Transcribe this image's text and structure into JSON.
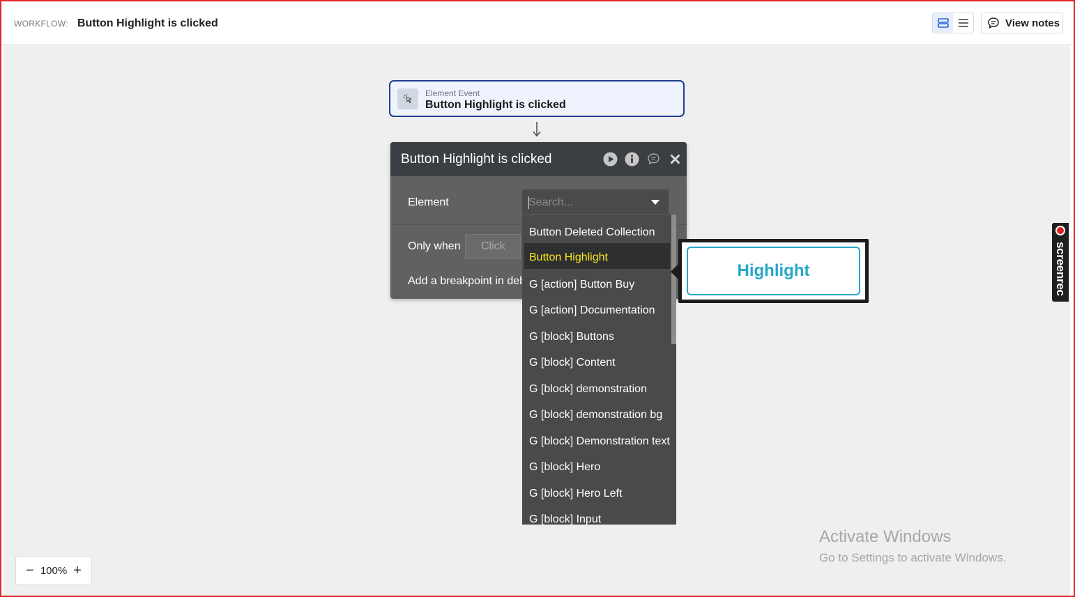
{
  "header": {
    "workflow_label": "WORKFLOW:",
    "workflow_title": "Button Highlight is clicked",
    "view_notes_label": "View notes"
  },
  "event_card": {
    "type": "Element Event",
    "name": "Button Highlight is clicked"
  },
  "panel": {
    "title": "Button Highlight is clicked",
    "element_label": "Element",
    "search_placeholder": "Search...",
    "only_when_label": "Only when",
    "only_when_value": "Click",
    "breakpoint_label": "Add a breakpoint in deb"
  },
  "dropdown": {
    "items": [
      {
        "label": "Button Deleted Collection",
        "selected": false
      },
      {
        "label": "Button Highlight",
        "selected": true
      },
      {
        "label": "G [action] Button Buy",
        "selected": false
      },
      {
        "label": "G [action] Documentation",
        "selected": false
      },
      {
        "label": "G [block] Buttons",
        "selected": false
      },
      {
        "label": "G [block] Content",
        "selected": false
      },
      {
        "label": "G [block] demonstration",
        "selected": false
      },
      {
        "label": "G [block] demonstration bg",
        "selected": false
      },
      {
        "label": "G [block] Demonstration text",
        "selected": false
      },
      {
        "label": "G [block] Hero",
        "selected": false
      },
      {
        "label": "G [block] Hero Left",
        "selected": false
      },
      {
        "label": "G [block] Input",
        "selected": false
      }
    ]
  },
  "preview": {
    "button_label": "Highlight",
    "accent_color": "#26a7c8"
  },
  "zoom": {
    "level": "100%",
    "minus": "−",
    "plus": "+"
  },
  "watermark": {
    "title": "Activate Windows",
    "subtitle": "Go to Settings to activate Windows."
  },
  "screenrec": {
    "label": "screenrec"
  },
  "colors": {
    "selected_text": "#f8e81c",
    "event_border": "#1f3c8f",
    "frame": "#e0252b"
  }
}
